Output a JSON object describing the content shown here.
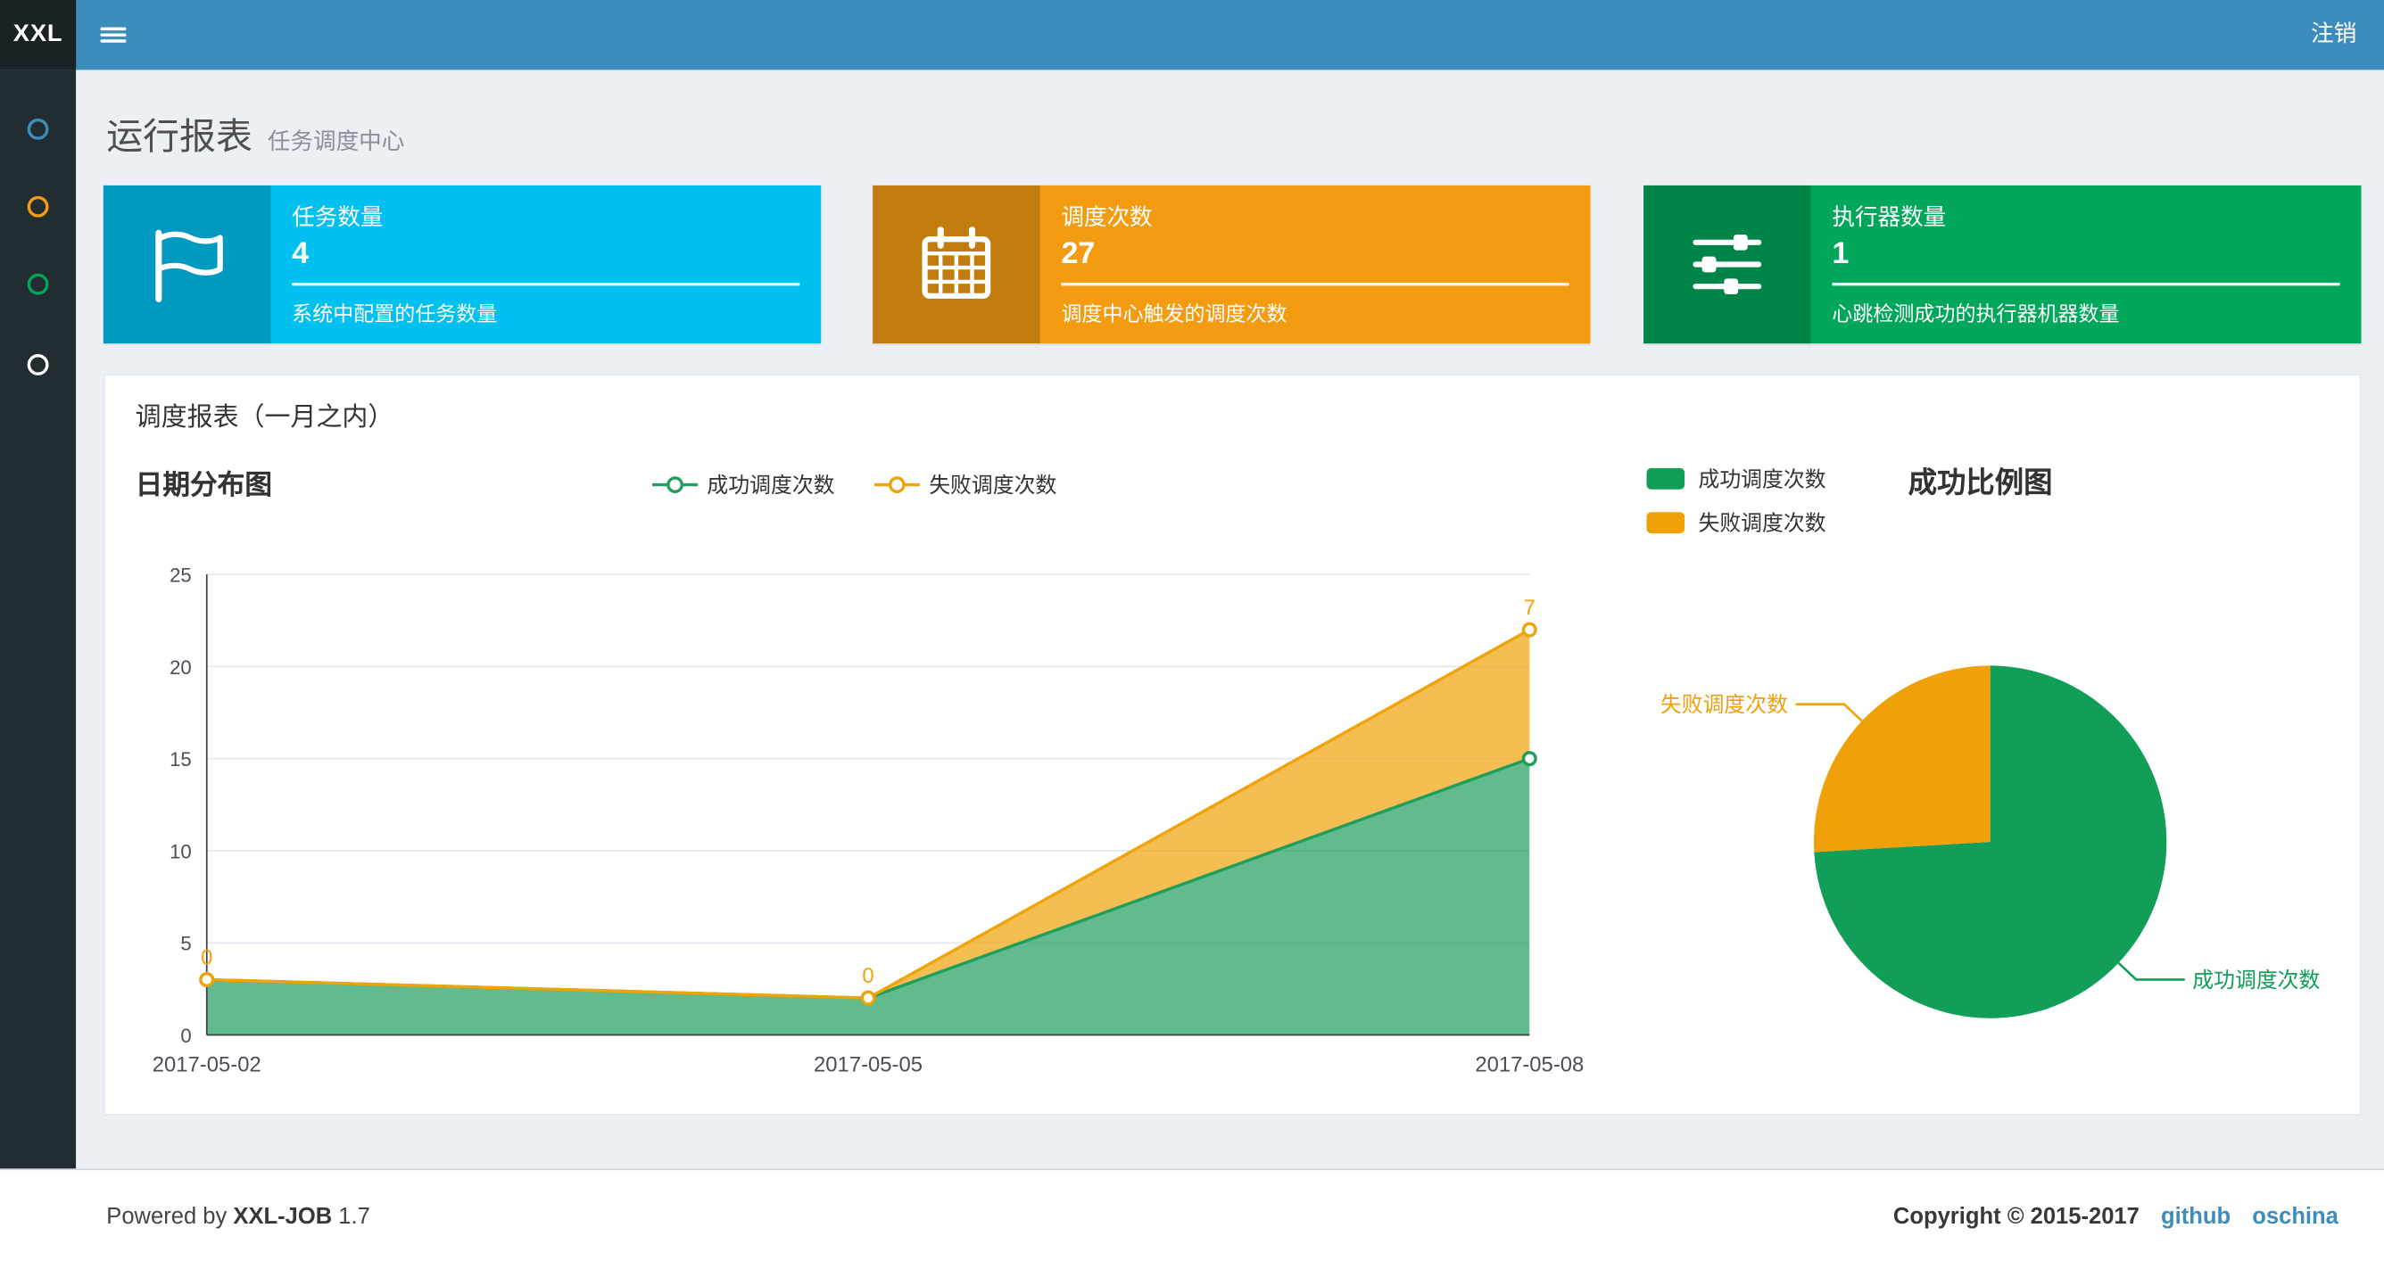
{
  "navbar": {
    "logo": "XXL",
    "logout_label": "注销"
  },
  "sidebar": {
    "items": [
      {
        "color": "#3c8dbc"
      },
      {
        "color": "#f39c12"
      },
      {
        "color": "#00a65a"
      },
      {
        "color": "#ffffff"
      }
    ]
  },
  "page_header": {
    "title": "运行报表",
    "subtitle": "任务调度中心"
  },
  "info_boxes": [
    {
      "label": "任务数量",
      "value": "4",
      "desc": "系统中配置的任务数量",
      "color": "#00c0ef",
      "icon": "flag-icon"
    },
    {
      "label": "调度次数",
      "value": "27",
      "desc": "调度中心触发的调度次数",
      "color": "#f39c12",
      "icon": "calendar-icon"
    },
    {
      "label": "执行器数量",
      "value": "1",
      "desc": "心跳检测成功的执行器机器数量",
      "color": "#00a65a",
      "icon": "sliders-icon"
    }
  ],
  "panel": {
    "title": "调度报表（一月之内）"
  },
  "chart_data": [
    {
      "type": "area",
      "title": "日期分布图",
      "x": [
        "2017-05-02",
        "2017-05-05",
        "2017-05-08"
      ],
      "stacked": true,
      "ylim": [
        0,
        25
      ],
      "yticks": [
        0,
        5,
        10,
        15,
        20,
        25
      ],
      "grid": true,
      "legend_position": "top",
      "series": [
        {
          "name": "成功调度次数",
          "values": [
            3,
            2,
            15
          ],
          "color": "#1f9e5c",
          "show_labels": false
        },
        {
          "name": "失败调度次数",
          "values": [
            0,
            0,
            7
          ],
          "color": "#f0a30a",
          "show_labels": true
        }
      ]
    },
    {
      "type": "pie",
      "title": "成功比例图",
      "legend_position": "top-left",
      "slices": [
        {
          "name": "成功调度次数",
          "value": 20,
          "color": "#109e58"
        },
        {
          "name": "失败调度次数",
          "value": 7,
          "color": "#f0a10a"
        }
      ]
    }
  ],
  "footer": {
    "powered_by": "Powered by",
    "product": "XXL-JOB",
    "version": "1.7",
    "copyright": "Copyright © 2015-2017",
    "links": [
      {
        "label": "github"
      },
      {
        "label": "oschina"
      }
    ]
  }
}
